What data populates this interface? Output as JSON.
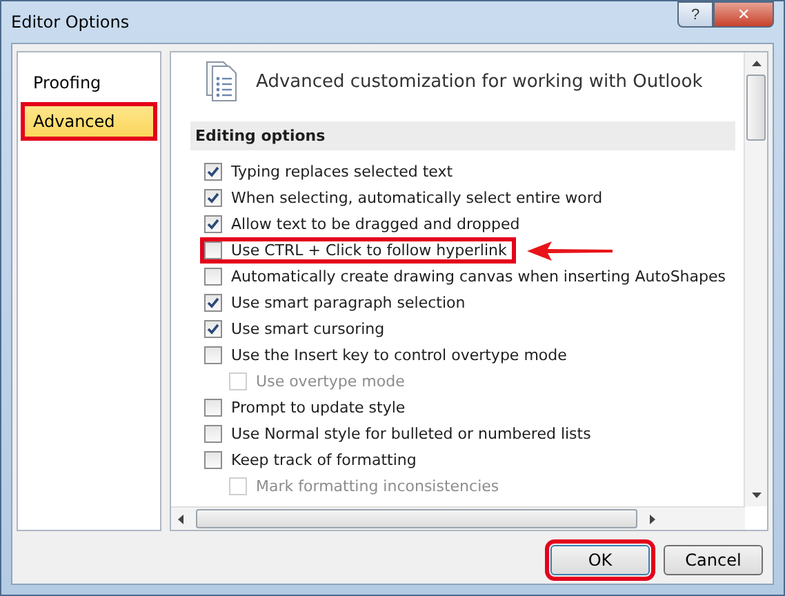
{
  "window": {
    "title": "Editor Options",
    "help_button": "?",
    "close_button": "✕"
  },
  "sidebar": {
    "items": [
      {
        "label": "Proofing",
        "selected": false,
        "highlighted": false
      },
      {
        "label": "Advanced",
        "selected": true,
        "highlighted": true
      }
    ]
  },
  "header": {
    "title": "Advanced customization for working with Outlook"
  },
  "section": {
    "title": "Editing options"
  },
  "options": [
    {
      "label": "Typing replaces selected text",
      "checked": true,
      "disabled": false,
      "highlighted": false
    },
    {
      "label": "When selecting, automatically select entire word",
      "checked": true,
      "disabled": false,
      "highlighted": false
    },
    {
      "label": "Allow text to be dragged and dropped",
      "checked": true,
      "disabled": false,
      "highlighted": false
    },
    {
      "label": "Use CTRL + Click to follow hyperlink",
      "checked": false,
      "disabled": false,
      "highlighted": true
    },
    {
      "label": "Automatically create drawing canvas when inserting AutoShapes",
      "checked": false,
      "disabled": false,
      "highlighted": false
    },
    {
      "label": "Use smart paragraph selection",
      "checked": true,
      "disabled": false,
      "highlighted": false
    },
    {
      "label": "Use smart cursoring",
      "checked": true,
      "disabled": false,
      "highlighted": false
    },
    {
      "label": "Use the Insert key to control overtype mode",
      "checked": false,
      "disabled": false,
      "highlighted": false,
      "children": [
        {
          "label": "Use overtype mode",
          "checked": false,
          "disabled": true,
          "highlighted": false
        }
      ]
    },
    {
      "label": "Prompt to update style",
      "checked": false,
      "disabled": false,
      "highlighted": false
    },
    {
      "label": "Use Normal style for bulleted or numbered lists",
      "checked": false,
      "disabled": false,
      "highlighted": false
    },
    {
      "label": "Keep track of formatting",
      "checked": false,
      "disabled": false,
      "highlighted": false,
      "children": [
        {
          "label": "Mark formatting inconsistencies",
          "checked": false,
          "disabled": true,
          "highlighted": false
        }
      ]
    }
  ],
  "buttons": [
    {
      "label": "OK",
      "highlighted": true
    },
    {
      "label": "Cancel",
      "highlighted": false
    }
  ]
}
